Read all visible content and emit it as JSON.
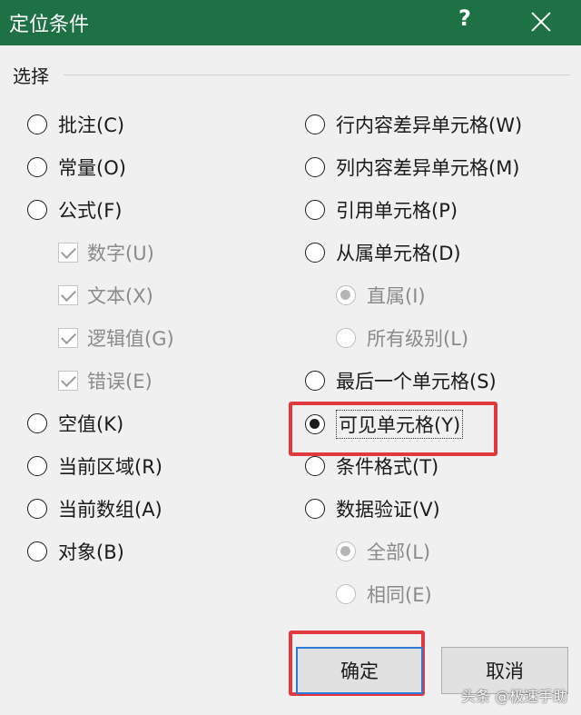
{
  "window": {
    "title": "定位条件",
    "help_label": "?"
  },
  "group": {
    "label": "选择"
  },
  "left_options": [
    {
      "label": "批注(C)",
      "checked": false
    },
    {
      "label": "常量(O)",
      "checked": false
    },
    {
      "label": "公式(F)",
      "checked": false
    },
    {
      "label": "数字(U)",
      "checked": true
    },
    {
      "label": "文本(X)",
      "checked": true
    },
    {
      "label": "逻辑值(G)",
      "checked": true
    },
    {
      "label": "错误(E)",
      "checked": true
    },
    {
      "label": "空值(K)",
      "checked": false
    },
    {
      "label": "当前区域(R)",
      "checked": false
    },
    {
      "label": "当前数组(A)",
      "checked": false
    },
    {
      "label": "对象(B)",
      "checked": false
    }
  ],
  "right_options": [
    {
      "label": "行内容差异单元格(W)",
      "checked": false
    },
    {
      "label": "列内容差异单元格(M)",
      "checked": false
    },
    {
      "label": "引用单元格(P)",
      "checked": false
    },
    {
      "label": "从属单元格(D)",
      "checked": false
    },
    {
      "label": "直属(I)",
      "checked": true
    },
    {
      "label": "所有级别(L)",
      "checked": false
    },
    {
      "label": "最后一个单元格(S)",
      "checked": false
    },
    {
      "label": "可见单元格(Y)",
      "checked": true
    },
    {
      "label": "条件格式(T)",
      "checked": false
    },
    {
      "label": "数据验证(V)",
      "checked": false
    },
    {
      "label": "全部(L)",
      "checked": true
    },
    {
      "label": "相同(E)",
      "checked": false
    }
  ],
  "buttons": {
    "ok": "确定",
    "cancel": "取消"
  },
  "watermark": "头条 @极速手助",
  "colors": {
    "titlebar": "#1e7145",
    "highlight": "#e0393e",
    "default_button_border": "#2a7bd6"
  }
}
